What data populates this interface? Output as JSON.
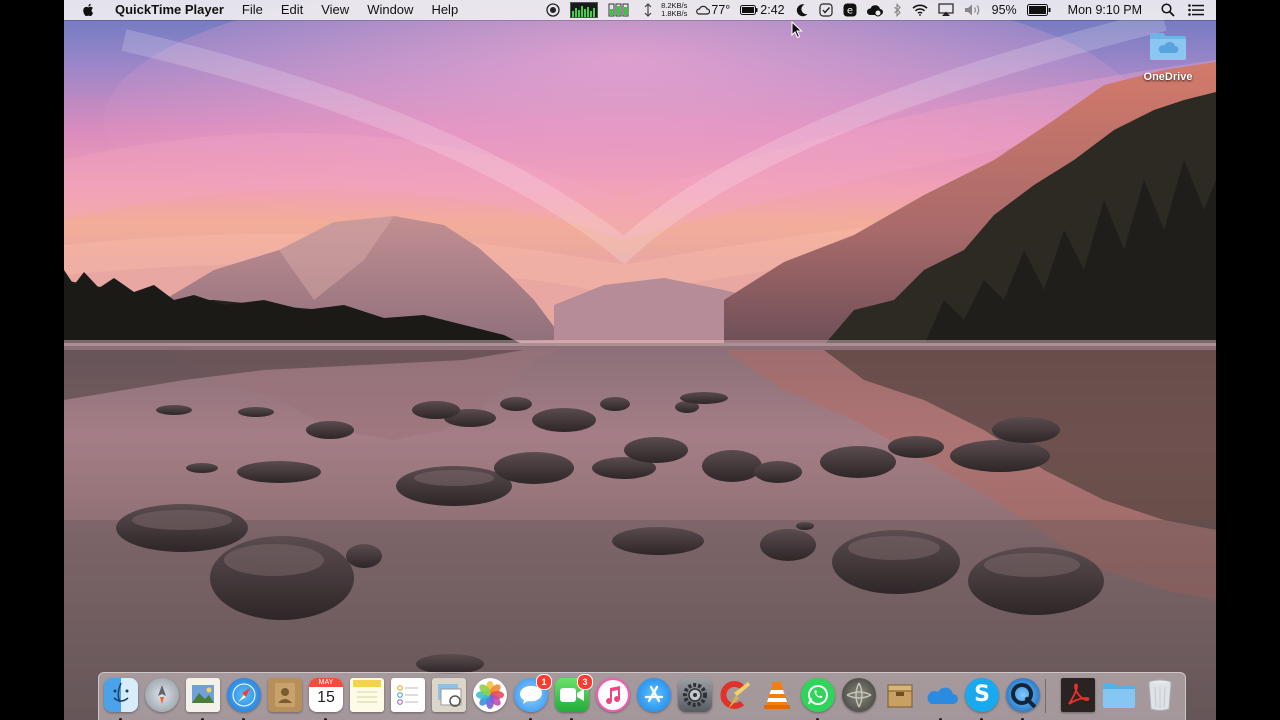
{
  "menu_bar": {
    "apple_icon": "apple-logo-icon",
    "app_name": "QuickTime Player",
    "menus": [
      "File",
      "Edit",
      "View",
      "Window",
      "Help"
    ],
    "status": {
      "net_up": "8.2KB/s",
      "net_down": "1.8KB/s",
      "temperature": "77°",
      "battery_time": "2:42",
      "battery_percent": "95%",
      "clock": "Mon 9:10 PM"
    }
  },
  "desktop": {
    "items": [
      {
        "label": "OneDrive",
        "icon": "onedrive-folder-icon"
      }
    ]
  },
  "dock": {
    "apps": [
      {
        "name": "Finder",
        "icon": "finder-icon",
        "running": true
      },
      {
        "name": "Launchpad",
        "icon": "launchpad-icon",
        "running": false
      },
      {
        "name": "Preview",
        "icon": "preview-icon",
        "running": true
      },
      {
        "name": "Safari",
        "icon": "safari-icon",
        "running": true
      },
      {
        "name": "Contacts",
        "icon": "contacts-icon",
        "running": false
      },
      {
        "name": "Calendar",
        "icon": "calendar-icon",
        "running": true,
        "calendar_month": "MAY",
        "calendar_day": "15"
      },
      {
        "name": "Notes",
        "icon": "notes-icon",
        "running": false
      },
      {
        "name": "Reminders",
        "icon": "reminders-icon",
        "running": false
      },
      {
        "name": "Preview Documents",
        "icon": "preview-docs-icon",
        "running": false
      },
      {
        "name": "Photos",
        "icon": "photos-icon",
        "running": false
      },
      {
        "name": "Messages",
        "icon": "messages-icon",
        "running": true,
        "badge": "1"
      },
      {
        "name": "FaceTime",
        "icon": "facetime-icon",
        "running": true,
        "badge": "3"
      },
      {
        "name": "iTunes",
        "icon": "itunes-icon",
        "running": false
      },
      {
        "name": "App Store",
        "icon": "app-store-icon",
        "running": false
      },
      {
        "name": "System Preferences",
        "icon": "system-preferences-icon",
        "running": false
      },
      {
        "name": "CCleaner",
        "icon": "ccleaner-icon",
        "running": false
      },
      {
        "name": "VLC",
        "icon": "vlc-icon",
        "running": false
      },
      {
        "name": "WhatsApp",
        "icon": "whatsapp-icon",
        "running": true
      },
      {
        "name": "Compressor",
        "icon": "compressor-icon",
        "running": false
      },
      {
        "name": "Archive Utility",
        "icon": "archive-icon",
        "running": false
      },
      {
        "name": "OneDrive",
        "icon": "onedrive-icon",
        "running": true
      },
      {
        "name": "Skype",
        "icon": "skype-icon",
        "running": true
      },
      {
        "name": "QuickTime Player",
        "icon": "quicktime-icon",
        "running": true
      }
    ],
    "others": [
      {
        "name": "Acrobat Reader",
        "icon": "acrobat-icon",
        "running": false
      },
      {
        "name": "Documents",
        "icon": "folder-icon",
        "running": false
      },
      {
        "name": "Trash",
        "icon": "trash-icon",
        "running": false
      }
    ]
  },
  "colors": {
    "menubar": "#eeecf0",
    "sky_top": "#5b7bc4",
    "sky_pink": "#e98fb2",
    "sky_orange": "#f1a987",
    "mountain": "#c88d8a",
    "forest": "#2a2a24",
    "lake": "#6e5a5e",
    "rock": "#3f3436"
  }
}
